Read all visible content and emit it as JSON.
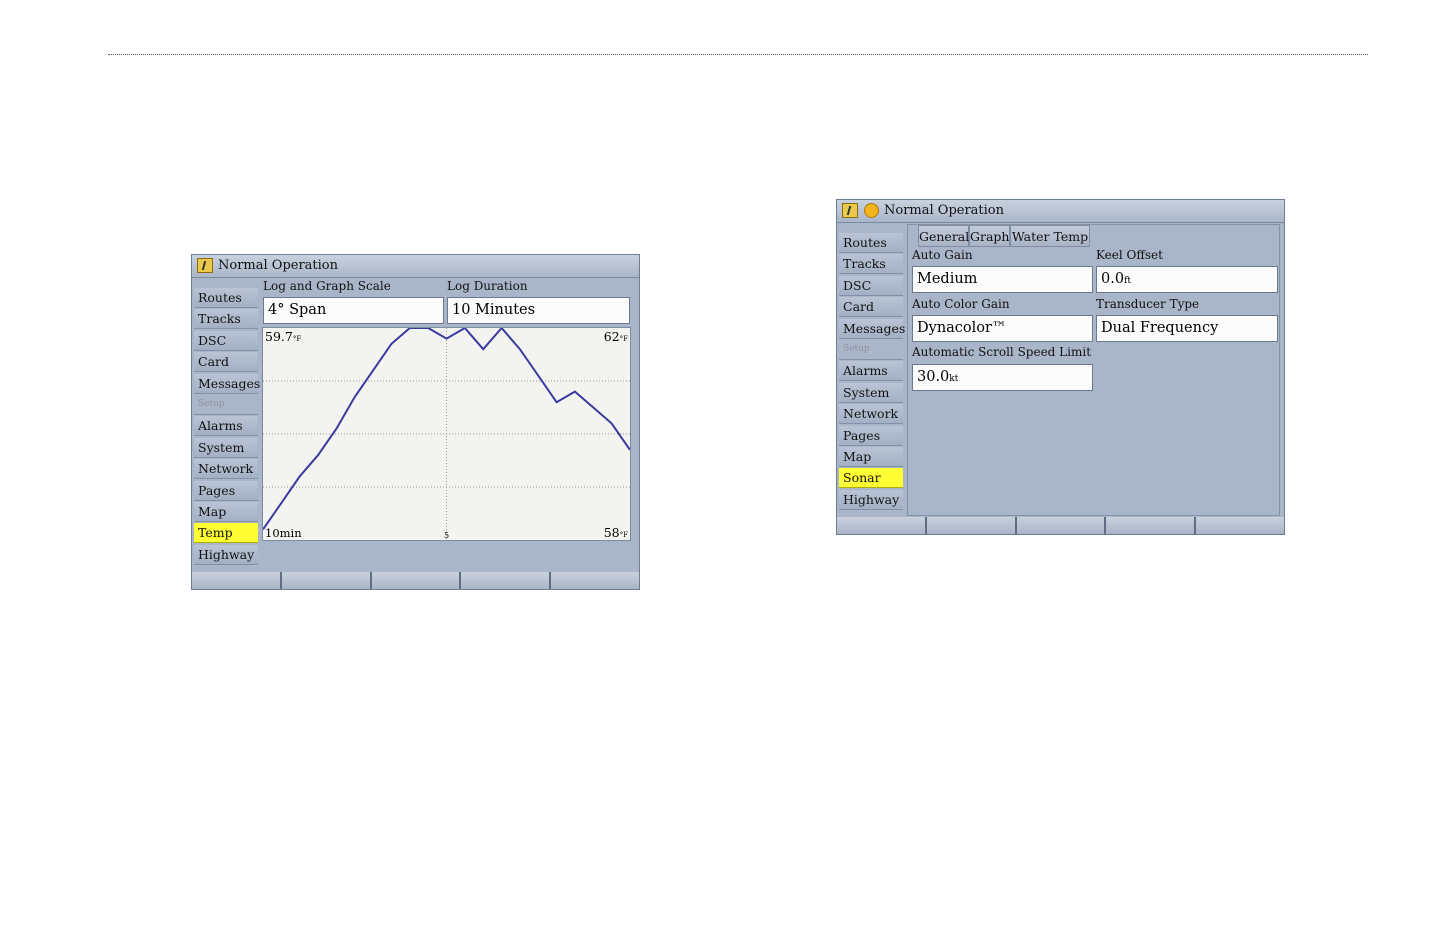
{
  "temp_screen": {
    "title": "Normal Operation",
    "sidebar": [
      {
        "label": "Routes"
      },
      {
        "label": "Tracks"
      },
      {
        "label": "DSC"
      },
      {
        "label": "Card"
      },
      {
        "label": "Messages"
      },
      {
        "label": "Setup"
      },
      {
        "label": "Alarms"
      },
      {
        "label": "System"
      },
      {
        "label": "Network"
      },
      {
        "label": "Pages"
      },
      {
        "label": "Map"
      },
      {
        "label": "Temp"
      },
      {
        "label": "Highway"
      }
    ],
    "selected": "Temp",
    "log_scale": {
      "label": "Log and Graph Scale",
      "value": "4° Span"
    },
    "log_duration": {
      "label": "Log Duration",
      "value": "10 Minutes"
    },
    "graph": {
      "current_temp": "59.7",
      "current_unit": "°F",
      "max_label": "62",
      "min_label": "58",
      "unit": "°F",
      "time_start": "10min",
      "time_mid": "5"
    }
  },
  "chart_data": {
    "type": "line",
    "x": [
      0,
      0.5,
      1,
      1.5,
      2,
      2.5,
      3,
      3.5,
      4,
      4.5,
      5,
      5.5,
      6,
      6.5,
      7,
      7.5,
      8,
      8.5,
      9,
      9.5,
      10
    ],
    "y": [
      58.2,
      58.7,
      59.2,
      59.6,
      60.1,
      60.7,
      61.2,
      61.7,
      62.0,
      62.0,
      61.8,
      62.0,
      61.6,
      62.0,
      61.6,
      61.1,
      60.6,
      60.8,
      60.5,
      60.2,
      59.7
    ],
    "xlim": [
      0,
      10
    ],
    "ylim": [
      58,
      62
    ],
    "grid": true,
    "color": "#3a3aa0"
  },
  "sonar_screen": {
    "title": "Normal Operation",
    "sidebar": [
      {
        "label": "Routes"
      },
      {
        "label": "Tracks"
      },
      {
        "label": "DSC"
      },
      {
        "label": "Card"
      },
      {
        "label": "Messages"
      },
      {
        "label": "Setup"
      },
      {
        "label": "Alarms"
      },
      {
        "label": "System"
      },
      {
        "label": "Network"
      },
      {
        "label": "Pages"
      },
      {
        "label": "Map"
      },
      {
        "label": "Sonar"
      },
      {
        "label": "Highway"
      }
    ],
    "selected": "Sonar",
    "tabs": [
      {
        "label": "General"
      },
      {
        "label": "Graph"
      },
      {
        "label": "Water Temp"
      }
    ],
    "fields": {
      "auto_gain": {
        "label": "Auto Gain",
        "value": "Medium"
      },
      "keel_offset": {
        "label": "Keel Offset",
        "value": "0.0",
        "unit": "ft"
      },
      "auto_color_gain": {
        "label": "Auto Color Gain",
        "value": "Dynacolor™"
      },
      "transducer_type": {
        "label": "Transducer Type",
        "value": "Dual Frequency"
      },
      "scroll_speed": {
        "label": "Automatic Scroll Speed Limit",
        "value": "30.0",
        "unit": "kt"
      }
    }
  },
  "colors": {
    "highlight": "#ffff33",
    "panel": "#a9b6ca",
    "line": "#3a3aa0"
  }
}
